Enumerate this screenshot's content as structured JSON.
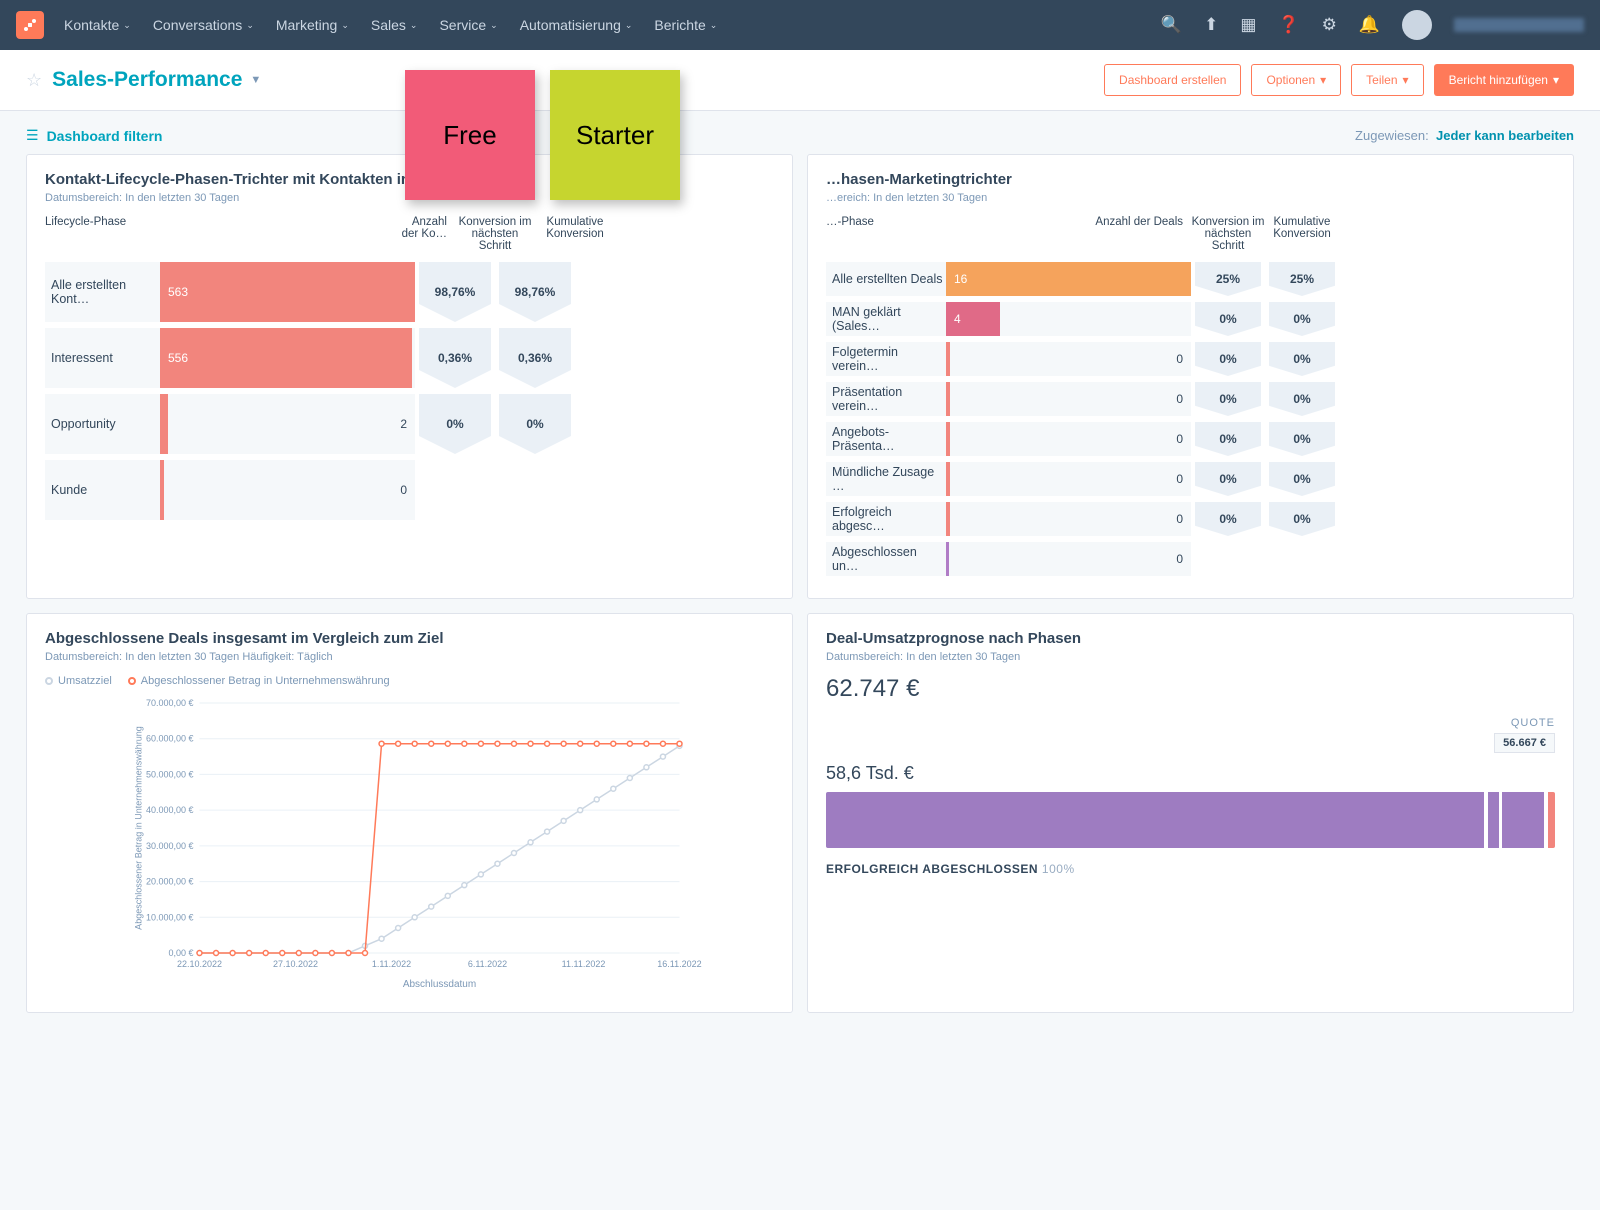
{
  "nav": {
    "items": [
      "Kontakte",
      "Conversations",
      "Marketing",
      "Sales",
      "Service",
      "Automatisierung",
      "Berichte"
    ]
  },
  "page": {
    "title": "Sales-Performance",
    "btn_create": "Dashboard erstellen",
    "btn_options": "Optionen",
    "btn_share": "Teilen",
    "btn_add": "Bericht hinzufügen"
  },
  "filter": {
    "label": "Dashboard filtern",
    "assigned_label": "Zugewiesen:",
    "assigned_value": "Jeder kann bearbeiten"
  },
  "stickies": {
    "free": "Free",
    "starter": "Starter"
  },
  "card1": {
    "title": "Kontakt-Lifecycle-Phasen-Trichter mit Kontakten insgesamt und K…",
    "sub": "Datumsbereich: In den letzten 30 Tagen",
    "head_phase": "Lifecycle-Phase",
    "head_count": "Anzahl der Ko…",
    "head_step": "Konversion im nächsten Schritt",
    "head_cum": "Kumulative Konversion",
    "rows": [
      {
        "label": "Alle erstellten Kont…",
        "value": "563",
        "pct": 100,
        "step": "98,76%",
        "cum": "98,76%"
      },
      {
        "label": "Interessent",
        "value": "556",
        "pct": 99,
        "step": "0,36%",
        "cum": "0,36%"
      },
      {
        "label": "Opportunity",
        "value": "2",
        "pct": 1,
        "step": "0%",
        "cum": "0%"
      },
      {
        "label": "Kunde",
        "value": "0",
        "pct": 0,
        "step": "",
        "cum": ""
      }
    ]
  },
  "card2": {
    "title": "…hasen-Marketingtrichter",
    "sub": "…ereich: In den letzten 30 Tagen",
    "head_phase": "…-Phase",
    "head_count": "Anzahl der Deals",
    "head_step": "Konversion im nächsten Schritt",
    "head_cum": "Kumulative Konversion",
    "rows": [
      {
        "label": "Alle erstellten Deals",
        "value": "16",
        "pct": 100,
        "cls": "orange",
        "step": "25%",
        "cum": "25%"
      },
      {
        "label": "MAN geklärt (Sales…",
        "value": "4",
        "pct": 22,
        "cls": "pink",
        "step": "0%",
        "cum": "0%"
      },
      {
        "label": "Folgetermin verein…",
        "value": "0",
        "pct": 0,
        "step": "0%",
        "cum": "0%"
      },
      {
        "label": "Präsentation verein…",
        "value": "0",
        "pct": 0,
        "step": "0%",
        "cum": "0%"
      },
      {
        "label": "Angebots-Präsenta…",
        "value": "0",
        "pct": 0,
        "step": "0%",
        "cum": "0%"
      },
      {
        "label": "Mündliche Zusage …",
        "value": "0",
        "pct": 0,
        "step": "0%",
        "cum": "0%"
      },
      {
        "label": "Erfolgreich abgesc…",
        "value": "0",
        "pct": 0,
        "step": "0%",
        "cum": "0%"
      },
      {
        "label": "Abgeschlossen un…",
        "value": "0",
        "pct": 0,
        "cls": "purple",
        "step": "",
        "cum": ""
      }
    ]
  },
  "card3": {
    "title": "Abgeschlossene Deals insgesamt im Vergleich zum Ziel",
    "sub": "Datumsbereich: In den letzten 30 Tagen   Häufigkeit: Täglich",
    "legend1": "Umsatzziel",
    "legend2": "Abgeschlossener Betrag in Unternehmenswährung",
    "ylabel": "Abgeschlossener Betrag in Unternehmenswährung",
    "xlabel": "Abschlussdatum"
  },
  "card4": {
    "title": "Deal-Umsatzprognose nach Phasen",
    "sub": "Datumsbereich: In den letzten 30 Tagen",
    "big": "62.747 €",
    "quote_label": "QUOTE",
    "quote_val": "56.667 €",
    "sub_amount": "58,6 Tsd. €",
    "status": "ERFOLGREICH ABGESCHLOSSEN",
    "status_pct": "100%"
  },
  "chart_data": {
    "type": "line",
    "xlabel": "Abschlussdatum",
    "ylabel": "Abgeschlossener Betrag in Unternehmenswährung",
    "x_ticks": [
      "22.10.2022",
      "27.10.2022",
      "1.11.2022",
      "6.11.2022",
      "11.11.2022",
      "16.11.2022"
    ],
    "y_ticks": [
      "0,00 €",
      "10.000,00 €",
      "20.000,00 €",
      "30.000,00 €",
      "40.000,00 €",
      "50.000,00 €",
      "60.000,00 €",
      "70.000,00 €"
    ],
    "ylim": [
      0,
      70000
    ],
    "series": [
      {
        "name": "Umsatzziel",
        "color": "#cbd6e2",
        "values": [
          0,
          0,
          0,
          0,
          0,
          0,
          0,
          0,
          0,
          0,
          2000,
          4000,
          7000,
          10000,
          13000,
          16000,
          19000,
          22000,
          25000,
          28000,
          31000,
          34000,
          37000,
          40000,
          43000,
          46000,
          49000,
          52000,
          55000,
          58000
        ]
      },
      {
        "name": "Abgeschlossener Betrag in Unternehmenswährung",
        "color": "#ff7a59",
        "values": [
          0,
          0,
          0,
          0,
          0,
          0,
          0,
          0,
          0,
          0,
          0,
          58600,
          58600,
          58600,
          58600,
          58600,
          58600,
          58600,
          58600,
          58600,
          58600,
          58600,
          58600,
          58600,
          58600,
          58600,
          58600,
          58600,
          58600,
          58600
        ]
      }
    ]
  }
}
